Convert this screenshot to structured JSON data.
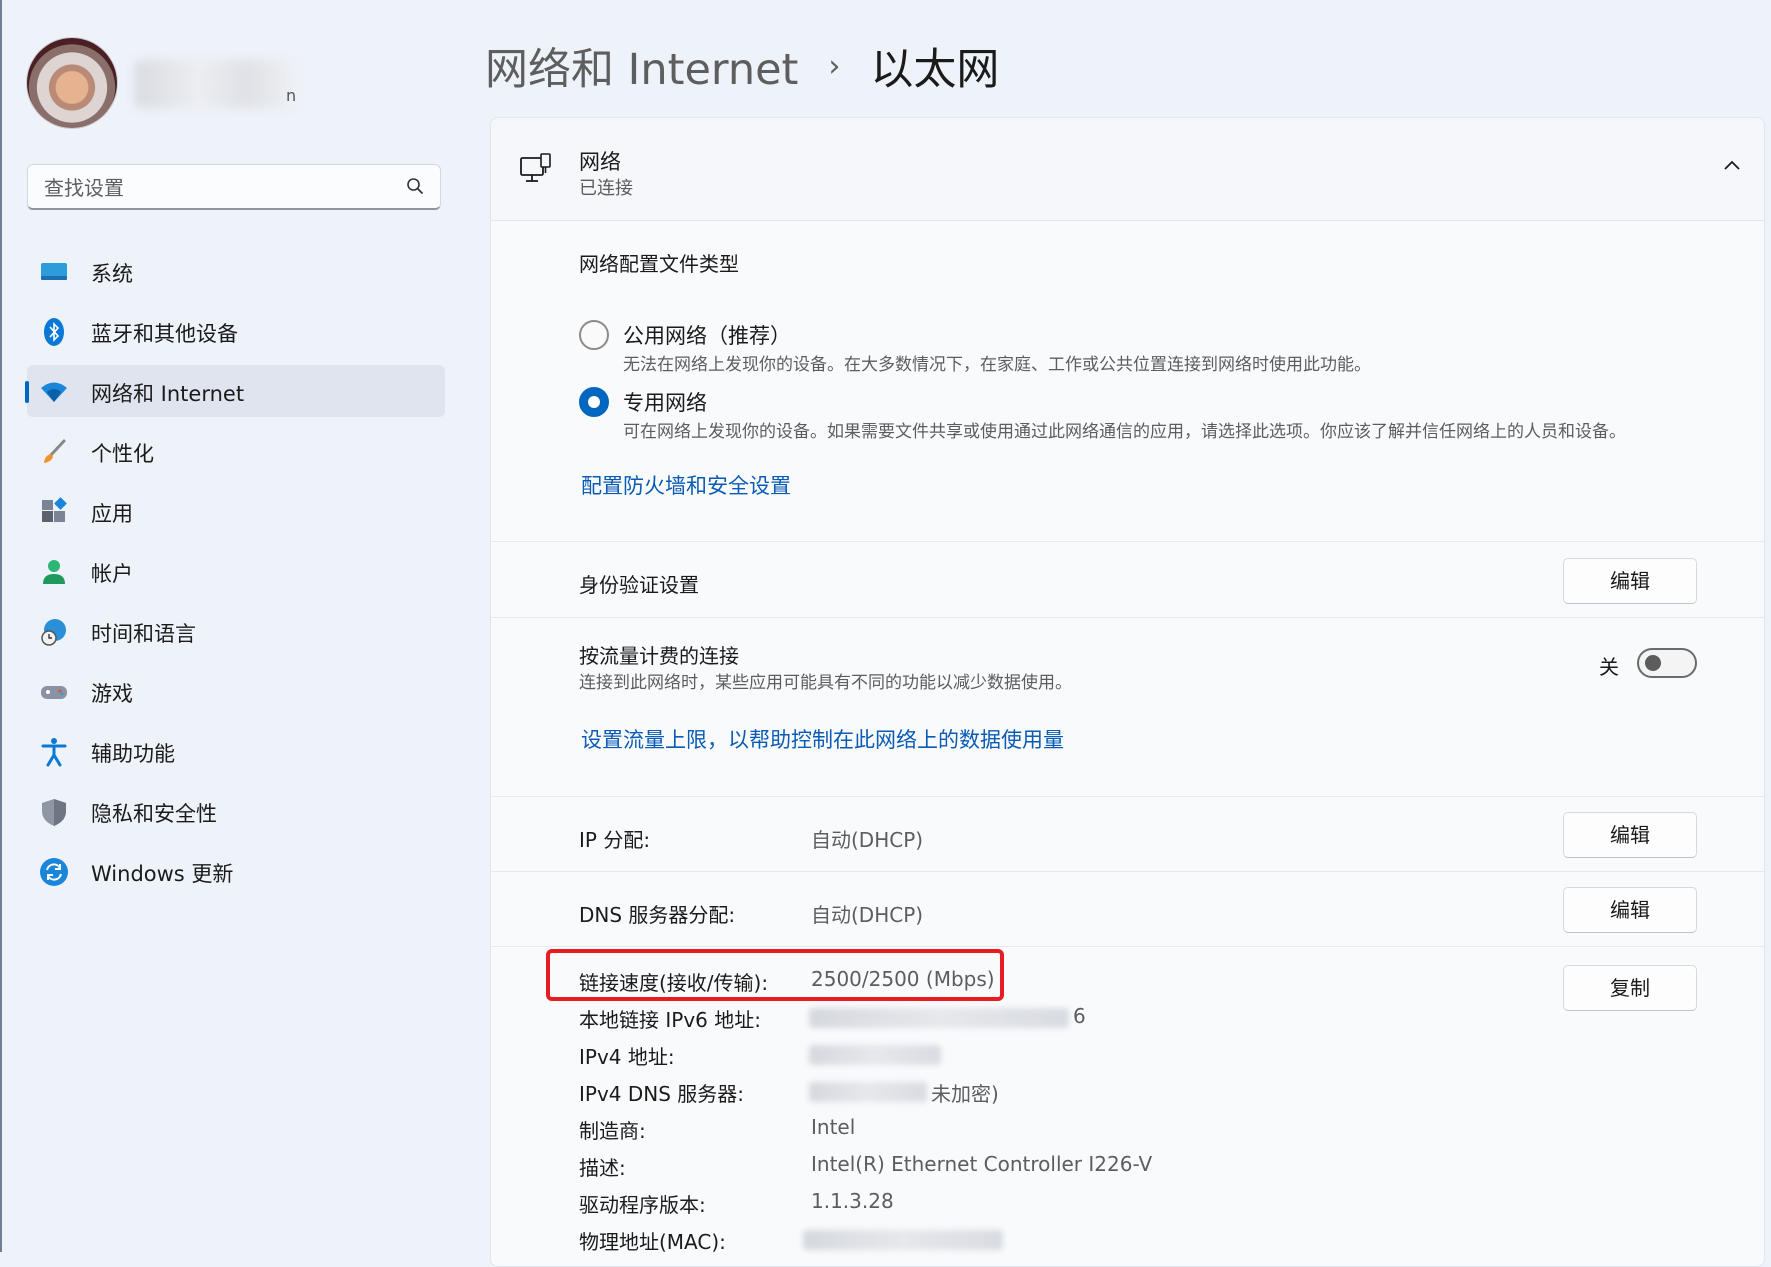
{
  "user": {
    "name_visible_tail": "n"
  },
  "search": {
    "placeholder": "查找设置"
  },
  "sidebar": {
    "items": [
      {
        "label": "系统",
        "icon": "monitor-icon"
      },
      {
        "label": "蓝牙和其他设备",
        "icon": "bluetooth-icon"
      },
      {
        "label": "网络和 Internet",
        "icon": "wifi-icon",
        "active": true
      },
      {
        "label": "个性化",
        "icon": "brush-icon"
      },
      {
        "label": "应用",
        "icon": "apps-icon"
      },
      {
        "label": "帐户",
        "icon": "account-icon"
      },
      {
        "label": "时间和语言",
        "icon": "globe-clock-icon"
      },
      {
        "label": "游戏",
        "icon": "gamepad-icon"
      },
      {
        "label": "辅助功能",
        "icon": "accessibility-icon"
      },
      {
        "label": "隐私和安全性",
        "icon": "shield-icon"
      },
      {
        "label": "Windows 更新",
        "icon": "update-icon"
      }
    ]
  },
  "breadcrumb": {
    "parent": "网络和 Internet",
    "separator": "›",
    "current": "以太网"
  },
  "card": {
    "title": "网络",
    "subtitle": "已连接",
    "profile_section": {
      "label": "网络配置文件类型",
      "options": [
        {
          "title": "公用网络（推荐）",
          "desc": "无法在网络上发现你的设备。在大多数情况下，在家庭、工作或公共位置连接到网络时使用此功能。",
          "selected": false
        },
        {
          "title": "专用网络",
          "desc": "可在网络上发现你的设备。如果需要文件共享或使用通过此网络通信的应用，请选择此选项。你应该了解并信任网络上的人员和设备。",
          "selected": true
        }
      ],
      "firewall_link": "配置防火墙和安全设置"
    },
    "auth": {
      "label": "身份验证设置",
      "button": "编辑"
    },
    "metered": {
      "label": "按流量计费的连接",
      "desc": "连接到此网络时，某些应用可能具有不同的功能以减少数据使用。",
      "toggle_state": "关",
      "toggle_on": false,
      "link": "设置流量上限，以帮助控制在此网络上的数据使用量"
    },
    "ip": {
      "label": "IP 分配:",
      "value": "自动(DHCP)",
      "button": "编辑"
    },
    "dns": {
      "label": "DNS 服务器分配:",
      "value": "自动(DHCP)",
      "button": "编辑"
    },
    "details": {
      "copy_button": "复制",
      "rows": [
        {
          "label": "链接速度(接收/传输):",
          "value": "2500/2500 (Mbps)"
        },
        {
          "label": "本地链接 IPv6 地址:",
          "value": "6"
        },
        {
          "label": "IPv4 地址:",
          "value": ""
        },
        {
          "label": "IPv4 DNS 服务器:",
          "value": "未加密)"
        },
        {
          "label": "制造商:",
          "value": "Intel"
        },
        {
          "label": "描述:",
          "value": "Intel(R) Ethernet Controller I226-V"
        },
        {
          "label": "驱动程序版本:",
          "value": "1.1.3.28"
        },
        {
          "label": "物理地址(MAC):",
          "value": ""
        }
      ]
    }
  },
  "colors": {
    "accent": "#0067c0",
    "link": "#0a5bb5",
    "highlight": "#e81b23"
  }
}
